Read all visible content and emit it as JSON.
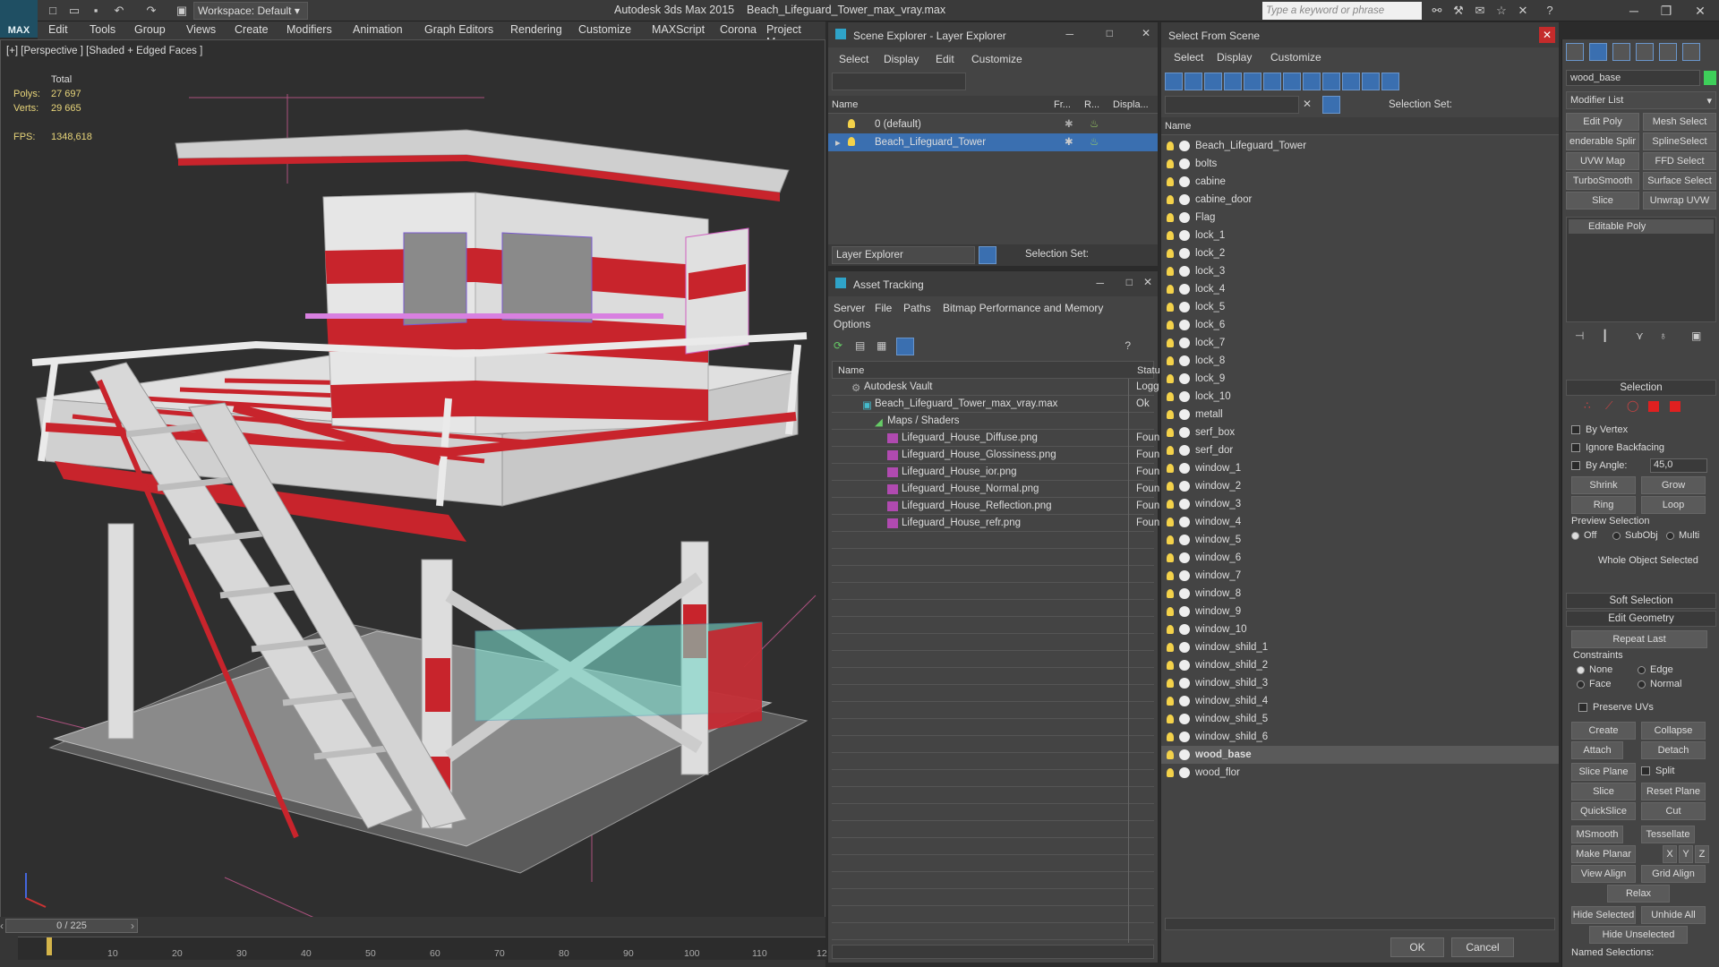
{
  "app": {
    "title": "Autodesk 3ds Max  2015",
    "file": "Beach_Lifeguard_Tower_max_vray.max",
    "workspace": "Workspace: Default",
    "search_placeholder": "Type a keyword or phrase",
    "logo": "MAX"
  },
  "menu": [
    "Edit",
    "Tools",
    "Group",
    "Views",
    "Create",
    "Modifiers",
    "Animation",
    "Graph Editors",
    "Rendering",
    "Customize",
    "MAXScript",
    "Corona",
    "Project Man"
  ],
  "viewport": {
    "label": "[+] [Perspective ] [Shaded + Edged Faces ]",
    "total_label": "Total",
    "polys_label": "Polys:",
    "polys": "27 697",
    "verts_label": "Verts:",
    "verts": "29 665",
    "fps_label": "FPS:",
    "fps": "1348,618"
  },
  "timeline": {
    "frame": "0 / 225",
    "ticks": [
      "10",
      "20",
      "30",
      "40",
      "50",
      "60",
      "70",
      "80",
      "90",
      "100",
      "110",
      "12"
    ]
  },
  "scene_explorer": {
    "title": "Scene Explorer - Layer Explorer",
    "menu": [
      "Select",
      "Display",
      "Edit",
      "Customize"
    ],
    "col_name": "Name",
    "col_fr": "Fr...",
    "col_r": "R...",
    "col_disp": "Displa...",
    "layers": [
      "0 (default)",
      "Beach_Lifeguard_Tower"
    ],
    "footer": "Layer Explorer",
    "selection_set": "Selection Set:"
  },
  "asset_tracking": {
    "title": "Asset Tracking",
    "menu": [
      "Server",
      "File",
      "Paths",
      "Bitmap Performance and Memory"
    ],
    "menu2": "Options",
    "col_name": "Name",
    "col_status": "Statu",
    "rows": [
      {
        "name": "Autodesk Vault",
        "status": "Logg"
      },
      {
        "name": "Beach_Lifeguard_Tower_max_vray.max",
        "status": "Ok"
      },
      {
        "name": "Maps / Shaders",
        "status": ""
      },
      {
        "name": "Lifeguard_House_Diffuse.png",
        "status": "Foun"
      },
      {
        "name": "Lifeguard_House_Glossiness.png",
        "status": "Foun"
      },
      {
        "name": "Lifeguard_House_ior.png",
        "status": "Foun"
      },
      {
        "name": "Lifeguard_House_Normal.png",
        "status": "Foun"
      },
      {
        "name": "Lifeguard_House_Reflection.png",
        "status": "Foun"
      },
      {
        "name": "Lifeguard_House_refr.png",
        "status": "Foun"
      }
    ]
  },
  "select_from_scene": {
    "title": "Select From Scene",
    "menu": [
      "Select",
      "Display",
      "Customize"
    ],
    "selection_set": "Selection Set:",
    "col_name": "Name",
    "objects": [
      "Beach_Lifeguard_Tower",
      "bolts",
      "cabine",
      "cabine_door",
      "Flag",
      "lock_1",
      "lock_2",
      "lock_3",
      "lock_4",
      "lock_5",
      "lock_6",
      "lock_7",
      "lock_8",
      "lock_9",
      "lock_10",
      "metall",
      "serf_box",
      "serf_dor",
      "window_1",
      "window_2",
      "window_3",
      "window_4",
      "window_5",
      "window_6",
      "window_7",
      "window_8",
      "window_9",
      "window_10",
      "window_shild_1",
      "window_shild_2",
      "window_shild_3",
      "window_shild_4",
      "window_shild_5",
      "window_shild_6",
      "wood_base",
      "wood_flor"
    ],
    "selected": "wood_base",
    "ok": "OK",
    "cancel": "Cancel"
  },
  "command_panel": {
    "object_name": "wood_base",
    "modifier_list": "Modifier List",
    "buttons": [
      "Edit Poly",
      "Mesh Select",
      "enderable Splir",
      "SplineSelect",
      "UVW Map",
      "FFD Select",
      "TurboSmooth",
      "Surface Select",
      "Slice",
      "Unwrap UVW"
    ],
    "stack": "Editable Poly",
    "selection": {
      "title": "Selection",
      "by_vertex": "By Vertex",
      "ignore_backfacing": "Ignore Backfacing",
      "by_angle": "By Angle:",
      "angle": "45,0",
      "shrink": "Shrink",
      "grow": "Grow",
      "ring": "Ring",
      "loop": "Loop",
      "preview": "Preview Selection",
      "off": "Off",
      "subobj": "SubObj",
      "multi": "Multi",
      "whole": "Whole Object Selected"
    },
    "soft_selection": "Soft Selection",
    "edit_geometry": "Edit Geometry",
    "repeat_last": "Repeat Last",
    "constraints": "Constraints",
    "none": "None",
    "edge": "Edge",
    "face": "Face",
    "normal": "Normal",
    "preserve_uvs": "Preserve UVs",
    "create": "Create",
    "collapse": "Collapse",
    "attach": "Attach",
    "detach": "Detach",
    "slice_plane": "Slice Plane",
    "split": "Split",
    "slice": "Slice",
    "reset_plane": "Reset Plane",
    "quickslice": "QuickSlice",
    "cut": "Cut",
    "msmooth": "MSmooth",
    "tessellate": "Tessellate",
    "make_planar": "Make Planar",
    "x": "X",
    "y": "Y",
    "z": "Z",
    "view_align": "View Align",
    "grid_align": "Grid Align",
    "relax": "Relax",
    "hide_selected": "Hide Selected",
    "unhide_all": "Unhide All",
    "hide_unselected": "Hide Unselected",
    "named_selections": "Named Selections:"
  }
}
